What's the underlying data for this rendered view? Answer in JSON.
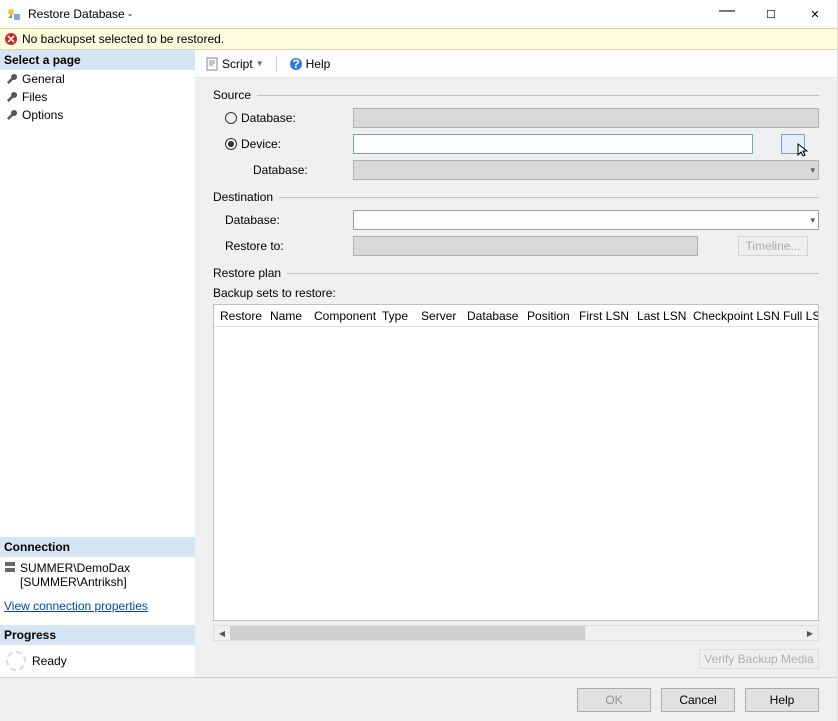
{
  "window": {
    "title": "Restore Database -"
  },
  "message": {
    "text": "No backupset selected to be restored."
  },
  "sidebar": {
    "header": "Select a page",
    "pages": [
      "General",
      "Files",
      "Options"
    ],
    "connection_header": "Connection",
    "connection_server": "SUMMER\\DemoDax",
    "connection_user": "[SUMMER\\Antriksh]",
    "view_conn": "View connection properties",
    "progress_header": "Progress",
    "progress_text": "Ready"
  },
  "toolbar": {
    "script": "Script",
    "help": "Help"
  },
  "source": {
    "title": "Source",
    "database_radio": "Database:",
    "device_radio": "Device:",
    "database_sub": "Database:"
  },
  "destination": {
    "title": "Destination",
    "database_label": "Database:",
    "restore_to_label": "Restore to:",
    "timeline_btn": "Timeline..."
  },
  "restore_plan": {
    "title": "Restore plan",
    "subtitle": "Backup sets to restore:",
    "columns": [
      "Restore",
      "Name",
      "Component",
      "Type",
      "Server",
      "Database",
      "Position",
      "First LSN",
      "Last LSN",
      "Checkpoint LSN",
      "Full LSN"
    ]
  },
  "verify_btn": "Verify Backup Media",
  "footer": {
    "ok": "OK",
    "cancel": "Cancel",
    "help": "Help"
  }
}
